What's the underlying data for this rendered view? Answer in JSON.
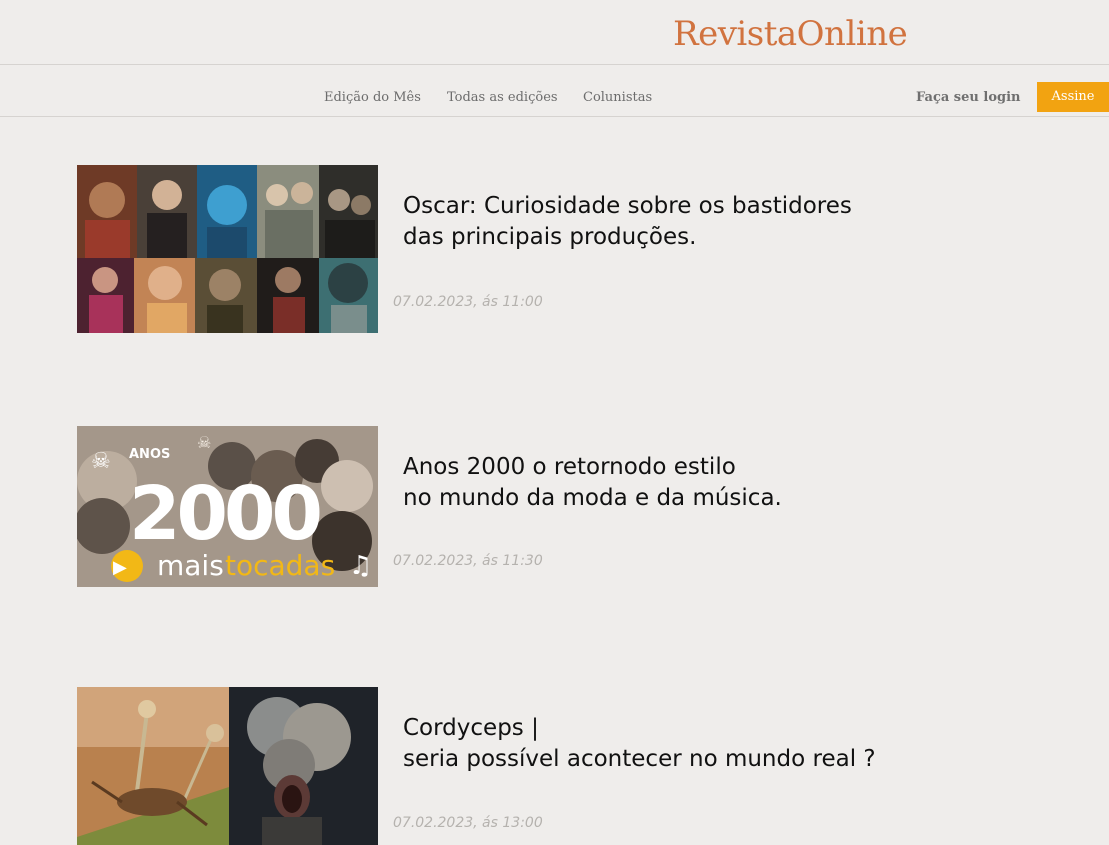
{
  "header": {
    "brand": "RevistaOnline"
  },
  "nav": {
    "items": [
      {
        "label": "Edição do Mês"
      },
      {
        "label": "Todas as edições"
      },
      {
        "label": "Colunistas"
      }
    ],
    "login_label": "Faça seu login",
    "subscribe_label": "Assine"
  },
  "colors": {
    "brand": "#d1733f",
    "accent": "#f2a311",
    "background": "#efedeb"
  },
  "articles": [
    {
      "title": "Oscar: Curiosidade sobre os bastidores\ndas principais produções.",
      "date": "07.02.2023, ás 11:00",
      "image": "oscar-movie-collage"
    },
    {
      "title": "Anos 2000 o retornodo estilo\nno mundo da moda e da música.",
      "date": "07.02.2023, ás 11:30",
      "image": "anos-2000-mais-tocadas",
      "image_text": {
        "top": "ANOS",
        "big": "2000",
        "logo_a": "mais",
        "logo_b": "tocadas"
      }
    },
    {
      "title": "Cordyceps |\nseria possível acontecer no mundo real ?",
      "date": "07.02.2023, ás 13:00",
      "image": "cordyceps-fungus-creature"
    }
  ]
}
